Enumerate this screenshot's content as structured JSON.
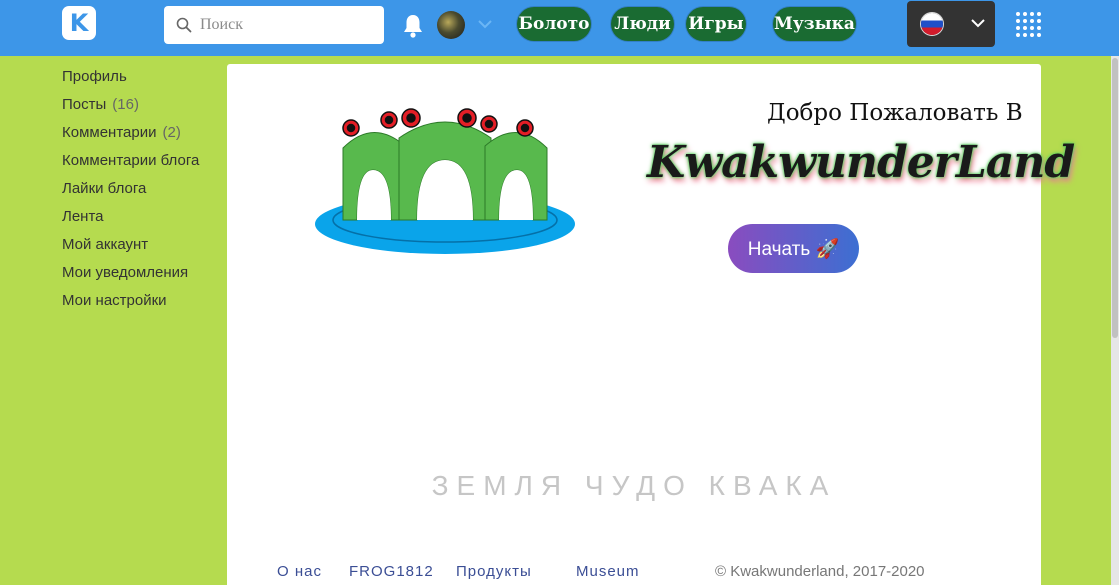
{
  "header": {
    "logo_letter": "K",
    "search": {
      "placeholder": "Поиск",
      "value": ""
    },
    "nav_pills": [
      "Болото",
      "Люди",
      "Игры",
      "Музыка"
    ],
    "language": "ru",
    "icons": [
      "search-icon",
      "bell-icon",
      "chevron-down-icon",
      "apps-grid-icon"
    ]
  },
  "sidebar": {
    "items": [
      {
        "label": "Профиль",
        "count": ""
      },
      {
        "label": "Посты",
        "count": "(16)"
      },
      {
        "label": "Комментарии",
        "count": "(2)"
      },
      {
        "label": "Комментарии блога",
        "count": ""
      },
      {
        "label": "Лайки блога",
        "count": ""
      },
      {
        "label": "Лента",
        "count": ""
      },
      {
        "label": "Мой аккаунт",
        "count": ""
      },
      {
        "label": "Мои уведомления",
        "count": ""
      },
      {
        "label": "Мои настройки",
        "count": ""
      }
    ]
  },
  "hero": {
    "welcome": "Добро Пожаловать В",
    "brand": "KwakwunderLand",
    "start_button": "Начать 🚀",
    "slogan": "ЗЕМЛЯ ЧУДО КВАКА"
  },
  "footer": {
    "links": [
      "О нас",
      "FROG1812",
      "Продукты",
      "Museum"
    ],
    "copyright": "© Kwakwunderland, 2017-2020"
  },
  "colors": {
    "topbar": "#3d96e8",
    "page_bg": "#b5db4f",
    "nav_pill": "#1a6b32",
    "start_gradient_from": "#8a4cbf",
    "start_gradient_to": "#3c6fd2"
  }
}
